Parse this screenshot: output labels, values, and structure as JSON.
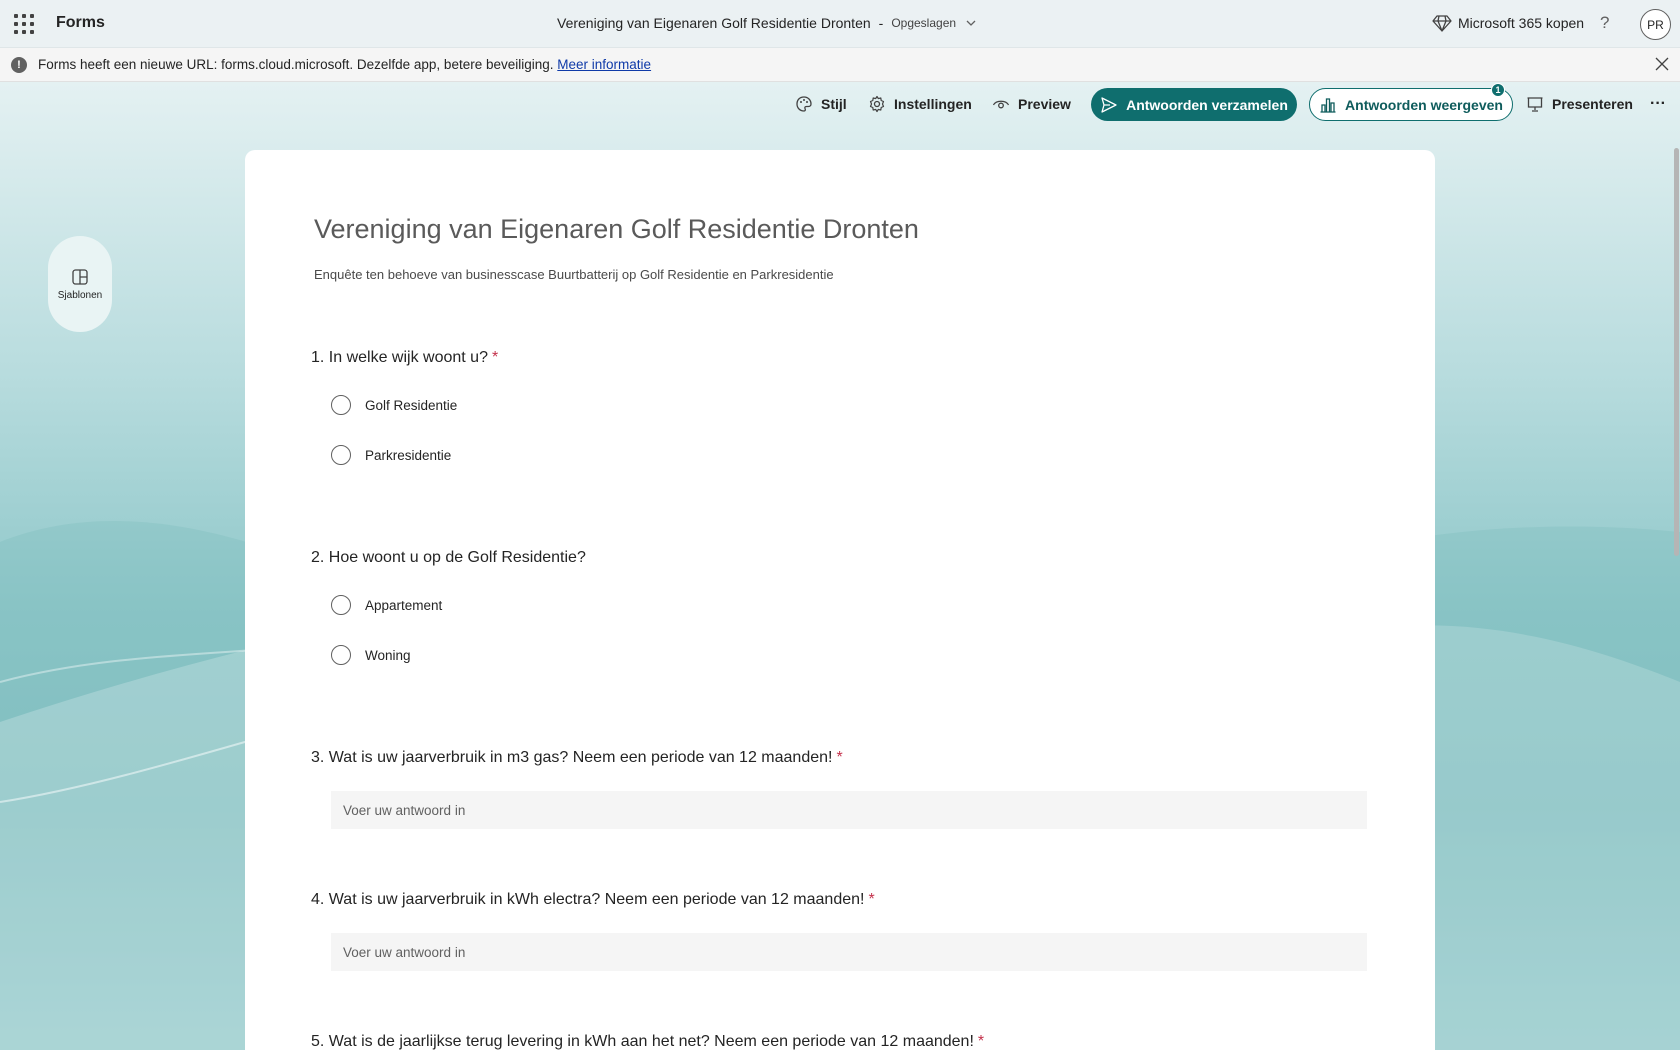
{
  "appbar": {
    "app_name": "Forms",
    "doc_title": "Vereniging van Eigenaren Golf Residentie Dronten",
    "separator": "-",
    "save_state": "Opgeslagen",
    "buy_label": "Microsoft 365 kopen",
    "help_label": "?",
    "avatar_initials": "PR"
  },
  "notice": {
    "message": "Forms heeft een nieuwe URL: forms.cloud.microsoft. Dezelfde app, betere beveiliging.",
    "link": "Meer informatie"
  },
  "commands": {
    "style": "Stijl",
    "settings": "Instellingen",
    "preview": "Preview",
    "collect": "Antwoorden verzamelen",
    "view_responses": "Antwoorden weergeven",
    "responses_badge": "1",
    "present": "Presenteren",
    "more": "···"
  },
  "sidebar": {
    "templates_label": "Sjablonen"
  },
  "form": {
    "title": "Vereniging van Eigenaren Golf Residentie Dronten",
    "subtitle": "Enquête ten behoeve van businesscase Buurtbatterij op Golf Residentie en Parkresidentie",
    "questions": [
      {
        "text": "1. In welke wijk woont u?",
        "required": "*",
        "options": [
          "Golf Residentie",
          "Parkresidentie"
        ]
      },
      {
        "text": "2. Hoe woont u op de Golf Residentie?",
        "options": [
          "Appartement",
          "Woning"
        ]
      },
      {
        "text": "3. Wat is uw jaarverbruik in m3 gas? Neem een periode van 12 maanden!",
        "required": "*",
        "placeholder": "Voer uw antwoord in"
      },
      {
        "text": "4. Wat is uw jaarverbruik in kWh electra? Neem een periode van 12 maanden!",
        "required": "*",
        "placeholder": "Voer uw antwoord in"
      },
      {
        "text": "5. Wat is de jaarlijkse terug levering in kWh aan het net? Neem een periode van 12 maanden!",
        "required": "*"
      }
    ]
  },
  "colors": {
    "accent": "#0f6e6e",
    "required": "#c4314b",
    "link": "#0f3aa8"
  }
}
